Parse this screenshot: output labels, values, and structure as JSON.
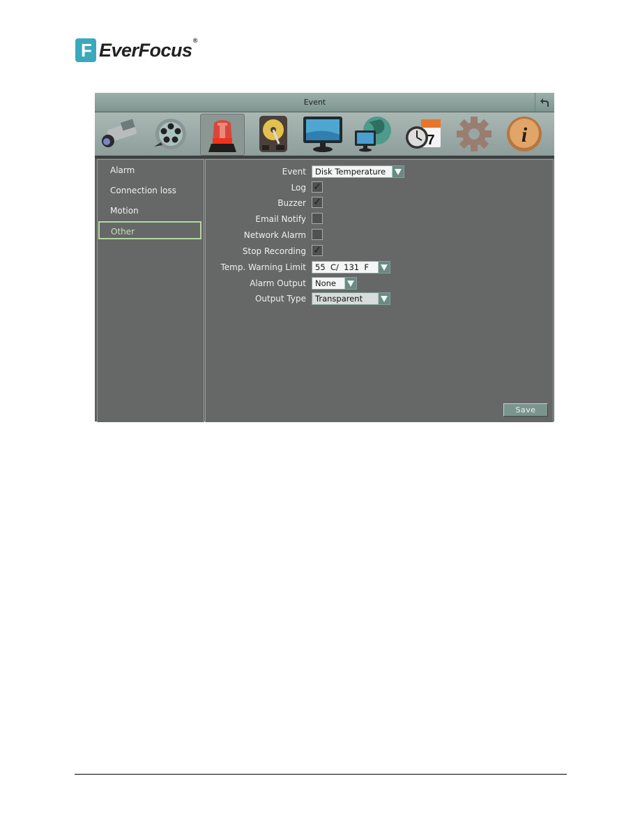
{
  "brand": {
    "logo_letter": "F",
    "name": "EverFocus",
    "reg": "®"
  },
  "window": {
    "title": "Event",
    "back_icon": "back-arrow-icon"
  },
  "toolbar": {
    "icons": [
      {
        "name": "camera-icon",
        "label": "Camera"
      },
      {
        "name": "record-reel-icon",
        "label": "Record"
      },
      {
        "name": "alarm-siren-icon",
        "label": "Event",
        "active": true
      },
      {
        "name": "hard-disk-icon",
        "label": "Disk"
      },
      {
        "name": "monitor-icon",
        "label": "Display"
      },
      {
        "name": "network-globe-icon",
        "label": "Network"
      },
      {
        "name": "clock-calendar-icon",
        "label": "Schedule",
        "calendar_day": "7"
      },
      {
        "name": "gear-icon",
        "label": "System"
      },
      {
        "name": "info-icon",
        "label": "Information",
        "glyph": "i"
      }
    ]
  },
  "sidebar": {
    "items": [
      {
        "label": "Alarm"
      },
      {
        "label": "Connection loss"
      },
      {
        "label": "Motion"
      },
      {
        "label": "Other",
        "active": true
      }
    ]
  },
  "form": {
    "event": {
      "label": "Event",
      "value": "Disk Temperature"
    },
    "log": {
      "label": "Log",
      "checked": true
    },
    "buzzer": {
      "label": "Buzzer",
      "checked": true
    },
    "email_notify": {
      "label": "Email Notify",
      "checked": false
    },
    "network_alarm": {
      "label": "Network Alarm",
      "checked": false
    },
    "stop_recording": {
      "label": "Stop Recording",
      "checked": true
    },
    "temp_warning_limit": {
      "label": "Temp. Warning Limit",
      "value": "55  C/  131  F"
    },
    "alarm_output": {
      "label": "Alarm Output",
      "value": "None"
    },
    "output_type": {
      "label": "Output Type",
      "value": "Transparent"
    },
    "check_glyph": "✓",
    "save_label": "Save"
  }
}
